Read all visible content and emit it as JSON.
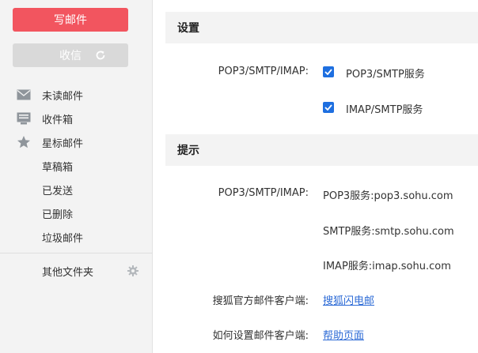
{
  "sidebar": {
    "compose_label": "写邮件",
    "receive_label": "收信",
    "items": [
      {
        "label": "未读邮件",
        "icon": "envelope-icon"
      },
      {
        "label": "收件箱",
        "icon": "inbox-icon"
      },
      {
        "label": "星标邮件",
        "icon": "star-icon"
      },
      {
        "label": "草稿箱",
        "icon": ""
      },
      {
        "label": "已发送",
        "icon": ""
      },
      {
        "label": "已删除",
        "icon": ""
      },
      {
        "label": "垃圾邮件",
        "icon": ""
      }
    ],
    "other_folders_label": "其他文件夹"
  },
  "settings": {
    "header": "设置",
    "protocol_label": "POP3/SMTP/IMAP:",
    "options": [
      {
        "label": "POP3/SMTP服务",
        "checked": true
      },
      {
        "label": "IMAP/SMTP服务",
        "checked": true
      }
    ]
  },
  "tips": {
    "header": "提示",
    "server_label": "POP3/SMTP/IMAP:",
    "servers": [
      "POP3服务:pop3.sohu.com",
      "SMTP服务:smtp.sohu.com",
      "IMAP服务:imap.sohu.com"
    ],
    "client_label": "搜狐官方邮件客户端:",
    "client_link": "搜狐闪电邮",
    "howto_label": "如何设置邮件客户端:",
    "howto_link": "帮助页面"
  },
  "colors": {
    "compose_bg": "#f2555f",
    "receive_bg": "#d9d9d9",
    "checkbox": "#1e6fe0",
    "link": "#2d6bd6"
  }
}
